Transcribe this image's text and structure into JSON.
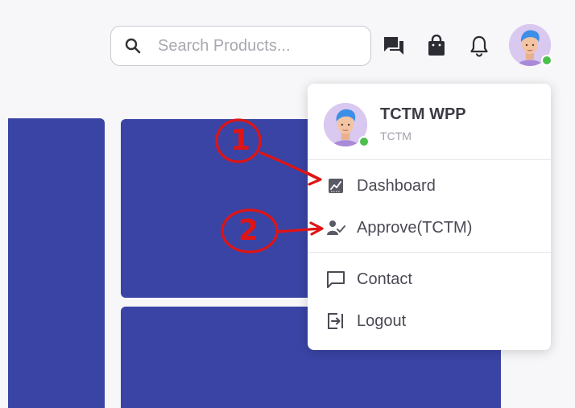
{
  "header": {
    "search": {
      "placeholder": "Search Products...",
      "value": ""
    },
    "icons": {
      "search": "search-icon",
      "messages": "chat-icon",
      "cart": "shopping-bag-icon",
      "notifications": "bell-icon"
    },
    "avatar_status": "online"
  },
  "user_menu": {
    "user": {
      "name": "TCTM WPP",
      "role": "TCTM",
      "status": "online"
    },
    "items": [
      {
        "label": "Dashboard",
        "icon": "chart-icon"
      },
      {
        "label": "Approve(TCTM)",
        "icon": "user-check-icon"
      },
      {
        "label": "Contact",
        "icon": "message-square-icon"
      },
      {
        "label": "Logout",
        "icon": "logout-icon"
      }
    ]
  },
  "annotations": [
    {
      "number": "1"
    },
    {
      "number": "2"
    }
  ],
  "colors": {
    "panel": "#3a44a4",
    "status_online": "#4cc04c",
    "annotation": "#e01414",
    "avatar_bg": "#d9c8f0"
  }
}
